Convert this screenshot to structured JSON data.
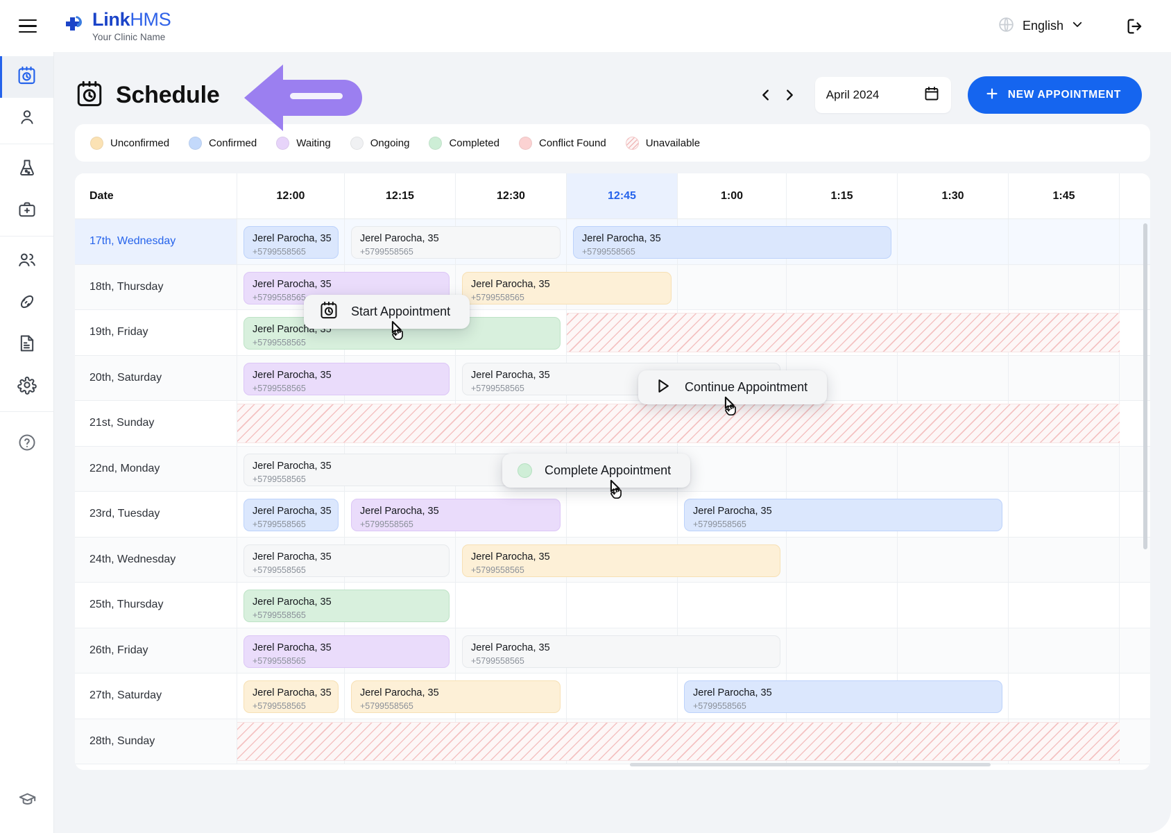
{
  "brand": {
    "name_part1": "Link",
    "name_part2": "HMS",
    "tagline": "Your Clinic Name"
  },
  "topbar": {
    "language": "English",
    "menu_icon": "hamburger-icon",
    "globe_icon": "globe-icon",
    "chevron_icon": "chevron-down-icon",
    "logout_icon": "logout-icon"
  },
  "sidebar": {
    "items": [
      {
        "name": "schedule",
        "icon": "calendar-clock-icon",
        "active": true
      },
      {
        "name": "patients",
        "icon": "user-icon",
        "active": false
      },
      {
        "name": "laboratory",
        "icon": "flask-icon",
        "active": false
      },
      {
        "name": "treatments",
        "icon": "medical-bag-icon",
        "active": false
      },
      {
        "name": "staff",
        "icon": "users-group-icon",
        "active": false
      },
      {
        "name": "procedures",
        "icon": "tooth-icon",
        "active": false
      },
      {
        "name": "billing",
        "icon": "invoice-icon",
        "active": false
      },
      {
        "name": "settings",
        "icon": "gear-icon",
        "active": false
      },
      {
        "name": "help",
        "icon": "question-circle-icon",
        "active": false
      }
    ],
    "bottom_item": {
      "name": "academy",
      "icon": "graduation-cap-icon"
    }
  },
  "page": {
    "title": "Schedule",
    "title_icon": "calendar-clock-icon",
    "prev_label": "‹",
    "next_label": "›",
    "month": "April 2024",
    "calendar_icon": "calendar-icon",
    "new_appointment_label": "NEW APPOINTMENT",
    "plus_icon": "plus-icon"
  },
  "legend": [
    {
      "label": "Unconfirmed",
      "color": "#fbe2b4",
      "style": "dot"
    },
    {
      "label": "Confirmed",
      "color": "#c3d9fb",
      "style": "dot"
    },
    {
      "label": "Waiting",
      "color": "#e7d4fa",
      "style": "dot"
    },
    {
      "label": "Ongoing",
      "color": "#f0f1f3",
      "style": "dot"
    },
    {
      "label": "Completed",
      "color": "#cdeed6",
      "style": "dot"
    },
    {
      "label": "Conflict Found",
      "color": "#fbd2d2",
      "style": "dot"
    },
    {
      "label": "Unavailable",
      "color": "#fdf5f5",
      "style": "hatch"
    }
  ],
  "grid": {
    "date_column_header": "Date",
    "time_columns": [
      "12:00",
      "12:15",
      "12:30",
      "12:45",
      "1:00",
      "1:15",
      "1:30",
      "1:45"
    ],
    "current_time_column": "12:45",
    "today_row": "17th, Wednesday",
    "rows": [
      {
        "date": "17th, Wednesday"
      },
      {
        "date": "18th, Thursday"
      },
      {
        "date": "19th, Friday"
      },
      {
        "date": "20th, Saturday"
      },
      {
        "date": "21st, Sunday"
      },
      {
        "date": "22nd, Monday"
      },
      {
        "date": "23rd, Tuesday"
      },
      {
        "date": "24th, Wednesday"
      },
      {
        "date": "25th, Thursday"
      },
      {
        "date": "26th, Friday"
      },
      {
        "date": "27th, Saturday"
      },
      {
        "date": "28th, Sunday"
      }
    ],
    "patient_name": "Jerel Parocha, 35",
    "patient_phone": "+5799558565",
    "appointments": [
      {
        "row": 0,
        "start": 0,
        "span": 1,
        "status": "confirmed",
        "name": "Jerel Parocha, 35",
        "phone": "+5799558565"
      },
      {
        "row": 0,
        "start": 1,
        "span": 2,
        "status": "ongoing",
        "name": "Jerel Parocha, 35",
        "phone": "+5799558565"
      },
      {
        "row": 0,
        "start": 3,
        "span": 3,
        "status": "confirmed",
        "name": "Jerel Parocha, 35",
        "phone": "+5799558565"
      },
      {
        "row": 1,
        "start": 0,
        "span": 2,
        "status": "waiting",
        "name": "Jerel Parocha, 35",
        "phone": "+5799558565"
      },
      {
        "row": 1,
        "start": 2,
        "span": 2,
        "status": "unconfirmed",
        "name": "Jerel Parocha, 35",
        "phone": "+5799558565"
      },
      {
        "row": 2,
        "start": 0,
        "span": 3,
        "status": "completed",
        "name": "Jerel Parocha, 35",
        "phone": "+5799558565"
      },
      {
        "row": 3,
        "start": 0,
        "span": 2,
        "status": "waiting",
        "name": "Jerel Parocha, 35",
        "phone": "+5799558565"
      },
      {
        "row": 3,
        "start": 2,
        "span": 3,
        "status": "ongoing",
        "name": "Jerel Parocha, 35",
        "phone": "+5799558565"
      },
      {
        "row": 5,
        "start": 0,
        "span": 3,
        "status": "ongoing",
        "name": "Jerel Parocha, 35",
        "phone": "+5799558565"
      },
      {
        "row": 6,
        "start": 0,
        "span": 1,
        "status": "confirmed",
        "name": "Jerel Parocha, 35",
        "phone": "+5799558565"
      },
      {
        "row": 6,
        "start": 1,
        "span": 2,
        "status": "waiting",
        "name": "Jerel Parocha, 35",
        "phone": "+5799558565"
      },
      {
        "row": 6,
        "start": 4,
        "span": 3,
        "status": "confirmed",
        "name": "Jerel Parocha, 35",
        "phone": "+5799558565"
      },
      {
        "row": 7,
        "start": 0,
        "span": 2,
        "status": "ongoing",
        "name": "Jerel Parocha, 35",
        "phone": "+5799558565"
      },
      {
        "row": 7,
        "start": 2,
        "span": 3,
        "status": "unconfirmed",
        "name": "Jerel Parocha, 35",
        "phone": "+5799558565"
      },
      {
        "row": 8,
        "start": 0,
        "span": 2,
        "status": "completed",
        "name": "Jerel Parocha, 35",
        "phone": "+5799558565"
      },
      {
        "row": 9,
        "start": 0,
        "span": 2,
        "status": "waiting",
        "name": "Jerel Parocha, 35",
        "phone": "+5799558565"
      },
      {
        "row": 9,
        "start": 2,
        "span": 3,
        "status": "ongoing",
        "name": "Jerel Parocha, 35",
        "phone": "+5799558565"
      },
      {
        "row": 10,
        "start": 0,
        "span": 1,
        "status": "unconfirmed",
        "name": "Jerel Parocha, 35",
        "phone": "+5799558565"
      },
      {
        "row": 10,
        "start": 1,
        "span": 2,
        "status": "unconfirmed",
        "name": "Jerel Parocha, 35",
        "phone": "+5799558565"
      },
      {
        "row": 10,
        "start": 4,
        "span": 3,
        "status": "confirmed",
        "name": "Jerel Parocha, 35",
        "phone": "+5799558565"
      }
    ],
    "unavailable_blocks": [
      {
        "row": 2,
        "start": 3,
        "span": 5
      },
      {
        "row": 4,
        "start": 0,
        "span": 8
      },
      {
        "row": 11,
        "start": 0,
        "span": 8
      }
    ]
  },
  "tooltips": [
    {
      "label": "Start Appointment",
      "icon": "calendar-clock-icon"
    },
    {
      "label": "Continue Appointment",
      "icon": "play-icon"
    },
    {
      "label": "Complete Appointment",
      "icon": "green-circle-icon"
    }
  ],
  "annotation": {
    "shape": "left-arrow",
    "color": "#9b7ff0"
  },
  "colors": {
    "accent": "#1565ef",
    "today": "#2563eb",
    "page_bg": "#f2f4f7"
  }
}
